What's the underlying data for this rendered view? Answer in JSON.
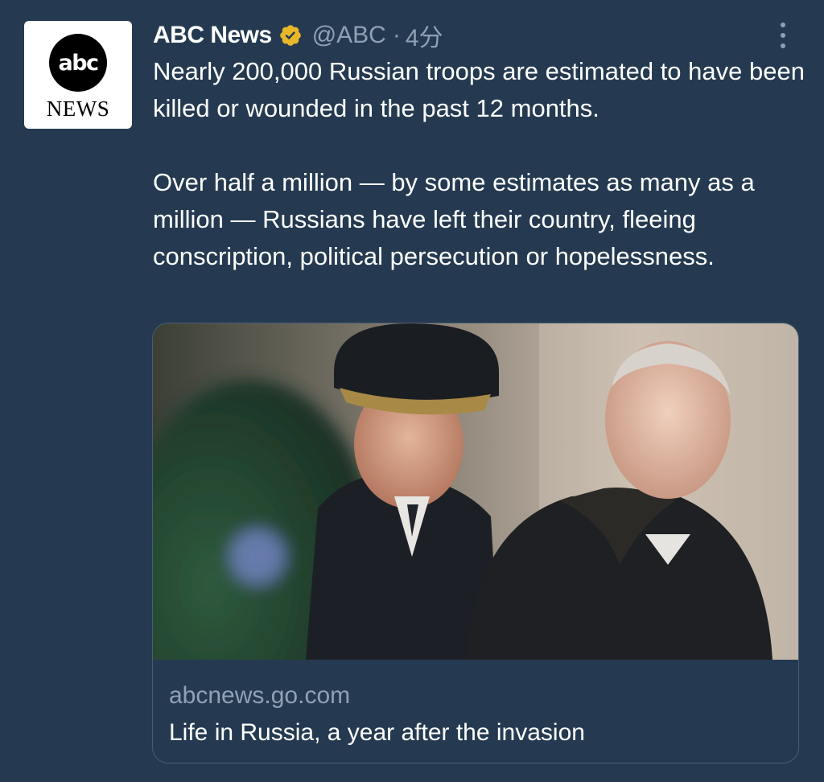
{
  "account": {
    "display_name": "ABC News",
    "handle": "@ABC",
    "separator": "·",
    "time": "4分",
    "verified_color": "#e8b829",
    "avatar_logo_text": "abc",
    "avatar_sub_text": "NEWS"
  },
  "tweet": {
    "paragraphs": [
      "Nearly 200,000 Russian troops are estimated to have been killed or wounded in the past 12 months.",
      "Over half a million — by some estimates as many as a million — Russians have left their country, fleeing conscription, political persecution or hopelessness."
    ]
  },
  "card": {
    "domain": "abcnews.go.com",
    "title": "Life in Russia, a year after the invasion"
  },
  "icons": {
    "verified": "verified-badge-icon",
    "more": "more-options-icon"
  },
  "colors": {
    "background": "#253a50",
    "secondary_text": "#8fa1b4",
    "card_border": "#4a5d72"
  }
}
